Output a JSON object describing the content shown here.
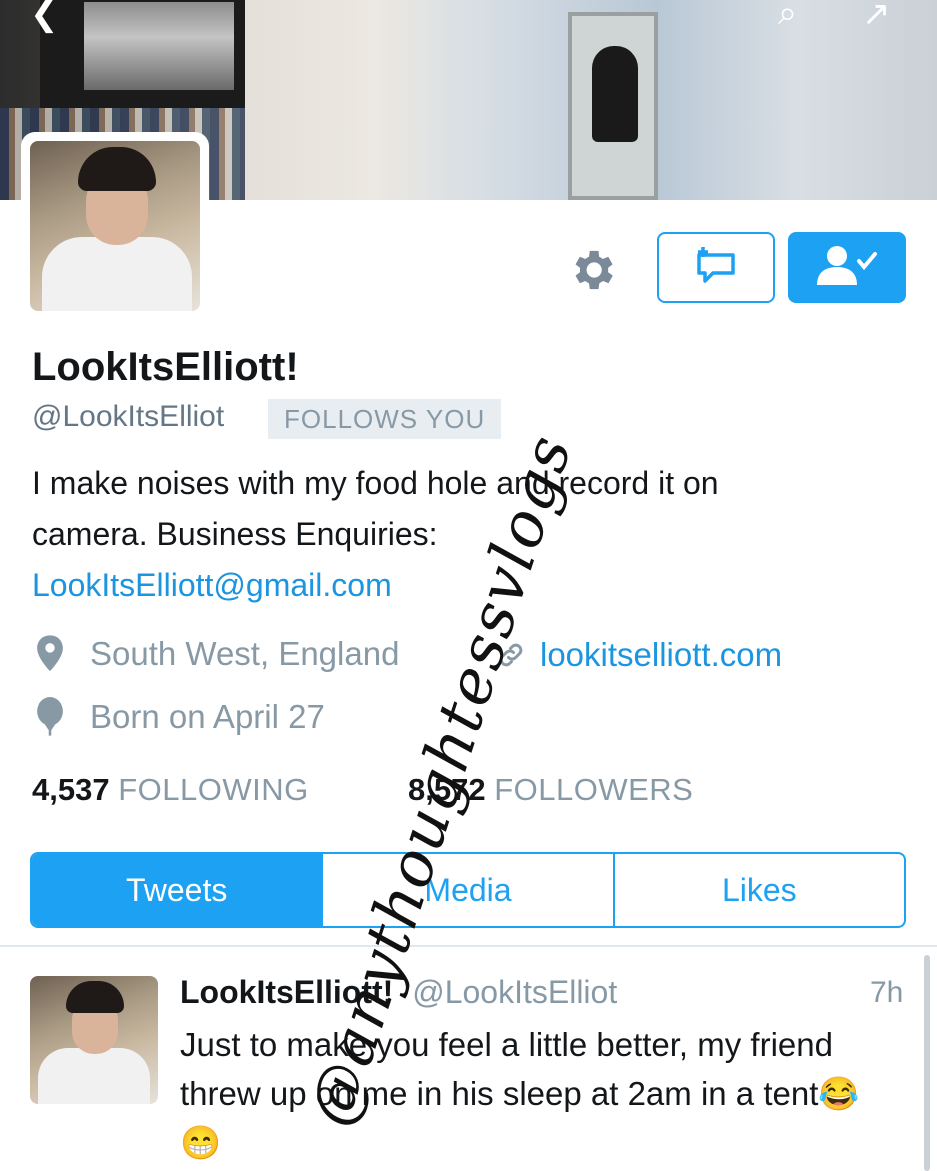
{
  "profile": {
    "name": "LookItsElliott!",
    "handle": "@LookItsElliot",
    "follows_you": "FOLLOWS YOU",
    "bio_line1": "I make noises with my food hole and record it on",
    "bio_line2": "camera. Business Enquiries:",
    "bio_email": "LookItsElliott@gmail.com",
    "location": "South West, England",
    "website": "lookitselliott.com",
    "birthday": "Born on April 27",
    "following_count": "4,537",
    "following_label": "FOLLOWING",
    "followers_count": "8,572",
    "followers_label": "FOLLOWERS"
  },
  "tabs": [
    "Tweets",
    "Media",
    "Likes"
  ],
  "active_tab": "Tweets",
  "tweet": {
    "name": "LookItsElliott!",
    "handle": "@LookItsElliot",
    "time": "7h",
    "text": "Just to make you feel a little better, my friend threw up on me in his sleep at 2am in a tent😂😁"
  },
  "watermark": "@anythoughtessvlogs",
  "icons": {
    "settings": "gear-icon",
    "message": "direct-message-icon",
    "following": "following-user-icon",
    "location": "location-pin-icon",
    "website": "link-icon",
    "birthday": "balloon-icon"
  },
  "colors": {
    "accent": "#1da1f2",
    "link": "#1b95e0",
    "muted": "#8899a6"
  }
}
